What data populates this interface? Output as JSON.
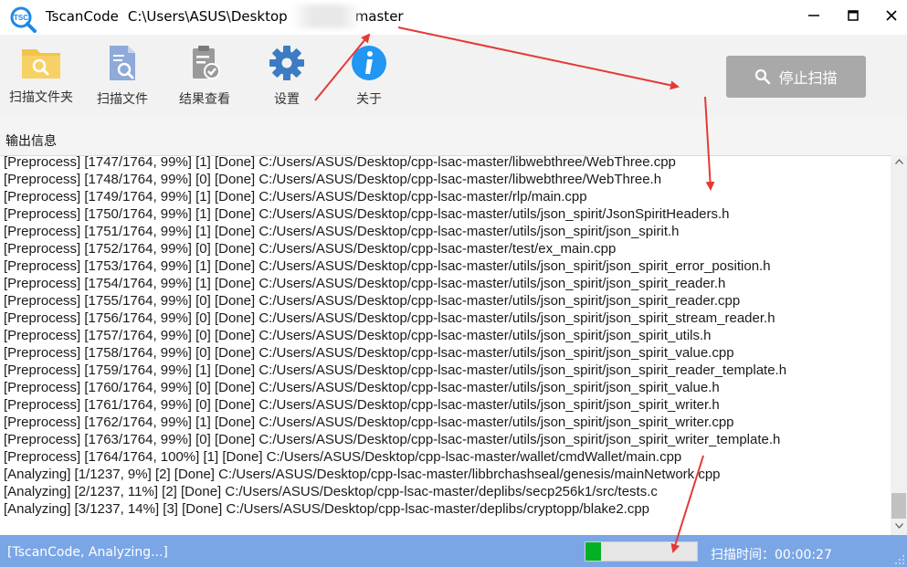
{
  "window": {
    "app_name": "TscanCode",
    "path_prefix": "C:\\Users\\ASUS\\Desktop",
    "path_suffix": "master",
    "icon_text": "TSC",
    "controls": [
      "minimize-icon",
      "maximize-icon",
      "close-icon"
    ]
  },
  "toolbar": {
    "items": [
      {
        "label": "扫描文件夹",
        "icon": "folder-search-icon"
      },
      {
        "label": "扫描文件",
        "icon": "file-search-icon"
      },
      {
        "label": "结果查看",
        "icon": "clipboard-check-icon"
      },
      {
        "label": "设置",
        "icon": "gear-icon"
      },
      {
        "label": "关于",
        "icon": "info-icon"
      }
    ],
    "stop_button_label": "停止扫描"
  },
  "output": {
    "title": "输出信息",
    "lines": [
      "[Preprocess] [1747/1764, 99%] [1] [Done] C:/Users/ASUS/Desktop/cpp-lsac-master/libwebthree/WebThree.cpp",
      "[Preprocess] [1748/1764, 99%] [0] [Done] C:/Users/ASUS/Desktop/cpp-lsac-master/libwebthree/WebThree.h",
      "[Preprocess] [1749/1764, 99%] [1] [Done] C:/Users/ASUS/Desktop/cpp-lsac-master/rlp/main.cpp",
      "[Preprocess] [1750/1764, 99%] [1] [Done] C:/Users/ASUS/Desktop/cpp-lsac-master/utils/json_spirit/JsonSpiritHeaders.h",
      "[Preprocess] [1751/1764, 99%] [1] [Done] C:/Users/ASUS/Desktop/cpp-lsac-master/utils/json_spirit/json_spirit.h",
      "[Preprocess] [1752/1764, 99%] [0] [Done] C:/Users/ASUS/Desktop/cpp-lsac-master/test/ex_main.cpp",
      "[Preprocess] [1753/1764, 99%] [1] [Done] C:/Users/ASUS/Desktop/cpp-lsac-master/utils/json_spirit/json_spirit_error_position.h",
      "[Preprocess] [1754/1764, 99%] [1] [Done] C:/Users/ASUS/Desktop/cpp-lsac-master/utils/json_spirit/json_spirit_reader.h",
      "[Preprocess] [1755/1764, 99%] [0] [Done] C:/Users/ASUS/Desktop/cpp-lsac-master/utils/json_spirit/json_spirit_reader.cpp",
      "[Preprocess] [1756/1764, 99%] [0] [Done] C:/Users/ASUS/Desktop/cpp-lsac-master/utils/json_spirit/json_spirit_stream_reader.h",
      "[Preprocess] [1757/1764, 99%] [0] [Done] C:/Users/ASUS/Desktop/cpp-lsac-master/utils/json_spirit/json_spirit_utils.h",
      "[Preprocess] [1758/1764, 99%] [0] [Done] C:/Users/ASUS/Desktop/cpp-lsac-master/utils/json_spirit/json_spirit_value.cpp",
      "[Preprocess] [1759/1764, 99%] [1] [Done] C:/Users/ASUS/Desktop/cpp-lsac-master/utils/json_spirit/json_spirit_reader_template.h",
      "[Preprocess] [1760/1764, 99%] [0] [Done] C:/Users/ASUS/Desktop/cpp-lsac-master/utils/json_spirit/json_spirit_value.h",
      "[Preprocess] [1761/1764, 99%] [0] [Done] C:/Users/ASUS/Desktop/cpp-lsac-master/utils/json_spirit/json_spirit_writer.h",
      "[Preprocess] [1762/1764, 99%] [1] [Done] C:/Users/ASUS/Desktop/cpp-lsac-master/utils/json_spirit/json_spirit_writer.cpp",
      "[Preprocess] [1763/1764, 99%] [0] [Done] C:/Users/ASUS/Desktop/cpp-lsac-master/utils/json_spirit/json_spirit_writer_template.h",
      "[Preprocess] [1764/1764, 100%] [1] [Done] C:/Users/ASUS/Desktop/cpp-lsac-master/wallet/cmdWallet/main.cpp",
      "[Analyzing] [1/1237, 9%] [2] [Done] C:/Users/ASUS/Desktop/cpp-lsac-master/libbrchashseal/genesis/mainNetwork.cpp",
      "[Analyzing] [2/1237, 11%] [2] [Done] C:/Users/ASUS/Desktop/cpp-lsac-master/deplibs/secp256k1/src/tests.c",
      "[Analyzing] [3/1237, 14%] [3] [Done] C:/Users/ASUS/Desktop/cpp-lsac-master/deplibs/cryptopp/blake2.cpp"
    ]
  },
  "status": {
    "text": "[TscanCode, Analyzing...]",
    "progress_fraction": 0.14,
    "scan_time": "扫描时间：00:00:27"
  },
  "colors": {
    "status_bar": "#7aa6e6",
    "progress_fill": "#06b025",
    "stop_button": "#a9a9a9",
    "annotation_arrow": "#e53935"
  }
}
